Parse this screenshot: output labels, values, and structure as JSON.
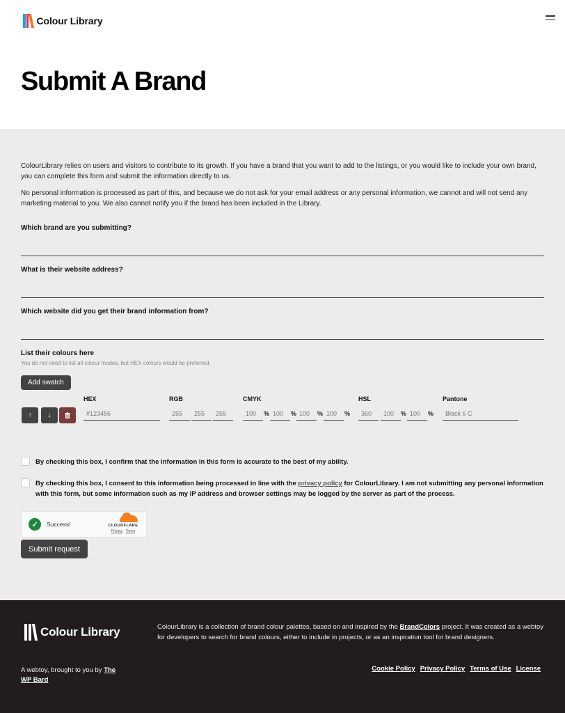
{
  "header": {
    "logo_text": "Colour Library",
    "logo_colors": [
      "#1fa0dc",
      "#e6245e",
      "#f07a1f"
    ],
    "menu_icon": "hamburger-icon"
  },
  "hero": {
    "title": "Submit A Brand"
  },
  "intro": {
    "paragraph_1": "ColourLibrary relies on users and visitors to contribute to its growth. If you have a brand that you want to add to the listings, or you would like to include your own brand, you can complete this form and submit the information directly to us.",
    "paragraph_2": "No personal information is processed as part of this, and because we do not ask for your email address or any personal information, we cannot and will not send any marketing material to you. We also cannot notify you if the brand has been included in the Library."
  },
  "form": {
    "questions": [
      {
        "label": "Which brand are you submitting?",
        "value": ""
      },
      {
        "label": "What is their website address?",
        "value": ""
      },
      {
        "label": "Which website did you get their brand information from?",
        "value": ""
      }
    ],
    "colours": {
      "heading": "List their colours here",
      "hint": "You do not need to list all colour modes, but HEX colours would be preferred.",
      "add_swatch_label": "Add swatch",
      "swatch": {
        "move_up_icon": "arrow-up-icon",
        "move_down_icon": "arrow-down-icon",
        "delete_icon": "trash-icon",
        "hex": {
          "label": "HEX",
          "placeholder": "#123456"
        },
        "rgb": {
          "label": "RGB",
          "placeholders": [
            "255",
            "255",
            "255"
          ]
        },
        "cmyk": {
          "label": "CMYK",
          "placeholders": [
            "100",
            "100",
            "100",
            "100"
          ],
          "unit": "%"
        },
        "hsl": {
          "label": "HSL",
          "placeholders": [
            "360",
            "100",
            "100"
          ],
          "unit": "%"
        },
        "pantone": {
          "label": "Pantone",
          "placeholder": "Black 6 C"
        }
      }
    },
    "checkbox_1": {
      "checked": false,
      "text": "By checking this box, I confirm that the information in this form is accurate to the best of my ability."
    },
    "checkbox_2": {
      "checked": false,
      "text_before": "By checking this box, I consent to this information being processed in line with the ",
      "link": "privacy policy",
      "text_after": " for ColourLibrary. I am not submitting any personal information with this form, but some information such as my IP address and browser settings may be logged by the server as part of the process."
    },
    "captcha": {
      "status": "Success!",
      "provider": "CLOUDFLARE",
      "privacy": "Privacy",
      "separator": "·",
      "terms": "Terms"
    },
    "submit_label": "Submit request"
  },
  "footer": {
    "logo_text": "Colour Library",
    "about_before": "ColourLibrary is a collection of brand colour palettes, based on and inspired by the ",
    "about_link": "BrandColors",
    "about_after": " project. It was created as a webtoy for developers to search for brand colours, either to include in projects, or as an inspiration tool for brand designers.",
    "credit_before": "A webtoy, brought to you by ",
    "credit_link": "The WP Bard",
    "links": [
      "Cookie Policy",
      "Privacy Policy",
      "Terms of Use",
      "License"
    ]
  }
}
